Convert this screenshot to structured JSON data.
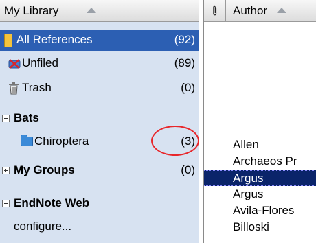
{
  "library": {
    "header": "My Library",
    "items": [
      {
        "label": "All References",
        "count": "(92)",
        "icon": "yellow-folder-icon"
      },
      {
        "label": "Unfiled",
        "count": "(89)",
        "icon": "unfiled-icon"
      },
      {
        "label": "Trash",
        "count": "(0)",
        "icon": "trash-icon"
      }
    ],
    "groups": [
      {
        "label": "Bats",
        "expander": "collapse-icon"
      },
      {
        "label": "Chiroptera",
        "count": "(3)",
        "icon": "blue-folder-icon"
      },
      {
        "label": "My Groups",
        "count": "(0)",
        "expander": "expand-icon"
      },
      {
        "label": "EndNote Web",
        "expander": "collapse-icon"
      },
      {
        "label": "configure..."
      }
    ]
  },
  "references": {
    "attachment_icon": "paperclip-icon",
    "author_header": "Author",
    "authors": [
      "Allen",
      "Archaeos Pr",
      "Argus",
      "Argus",
      "Avila-Flores",
      "Billoski"
    ],
    "selected_index": 2
  },
  "colors": {
    "pane_background": "#d7e2f1",
    "selected_library_row": "#2c5fb3",
    "selected_reference_row": "#0a246a",
    "annotation_circle": "#e8262a"
  }
}
